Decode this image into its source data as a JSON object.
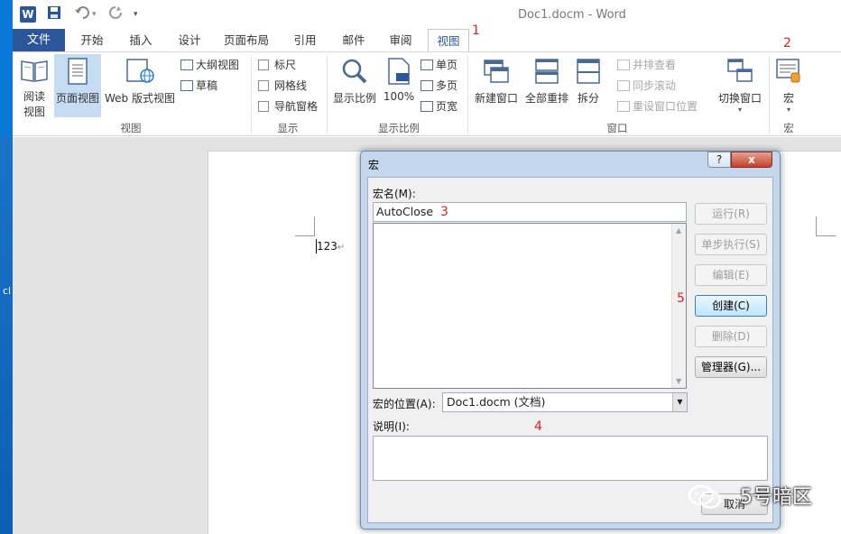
{
  "window": {
    "app_logo": "W",
    "title": "Doc1.docm - Word",
    "quick_access": [
      "save-icon",
      "undo-icon",
      "redo-icon",
      "customize-icon"
    ]
  },
  "tabs": {
    "file": "文件",
    "items": [
      "开始",
      "插入",
      "设计",
      "页面布局",
      "引用",
      "邮件",
      "审阅",
      "视图"
    ],
    "active": "视图"
  },
  "annotations": {
    "n1": "1",
    "n2": "2",
    "n3": "3",
    "n4": "4",
    "n5": "5"
  },
  "ribbon": {
    "views": {
      "label": "视图",
      "read_mode": "阅读视图",
      "read_mode_line1": "阅读",
      "read_mode_line2": "视图",
      "print_layout": "页面视图",
      "web_layout": "Web 版式视图",
      "outline": "大纲视图",
      "draft": "草稿"
    },
    "show": {
      "label": "显示",
      "ruler": "标尺",
      "gridlines": "网格线",
      "nav_pane": "导航窗格"
    },
    "zoom": {
      "label": "显示比例",
      "zoom": "显示比例",
      "hundred": "100%",
      "one_page": "单页",
      "multi_page": "多页",
      "page_width": "页宽"
    },
    "window": {
      "label": "窗口",
      "new_window": "新建窗口",
      "arrange_all": "全部重排",
      "split": "拆分",
      "side_by_side": "并排查看",
      "sync_scroll": "同步滚动",
      "reset_position": "重设窗口位置",
      "switch_windows": "切换窗口"
    },
    "macros": {
      "label": "宏",
      "macros": "宏"
    }
  },
  "document": {
    "text": "123"
  },
  "dialog": {
    "title": "宏",
    "help": "?",
    "close": "x",
    "macro_name_label": "宏名(M):",
    "macro_name_value": "AutoClose",
    "buttons": {
      "run": "运行(R)",
      "step_into": "单步执行(S)",
      "edit": "编辑(E)",
      "create": "创建(C)",
      "delete": "删除(D)",
      "organizer": "管理器(G)...",
      "cancel": "取消"
    },
    "macros_in_label": "宏的位置(A):",
    "macros_in_value": "Doc1.docm (文档)",
    "description_label": "说明(I):"
  },
  "desktop": {
    "stub": "cl"
  },
  "watermark": {
    "text": "5号暗区"
  },
  "colors": {
    "accent": "#2b579a",
    "annotation": "#e02020",
    "dialog_frame": "#c4d7ed"
  }
}
